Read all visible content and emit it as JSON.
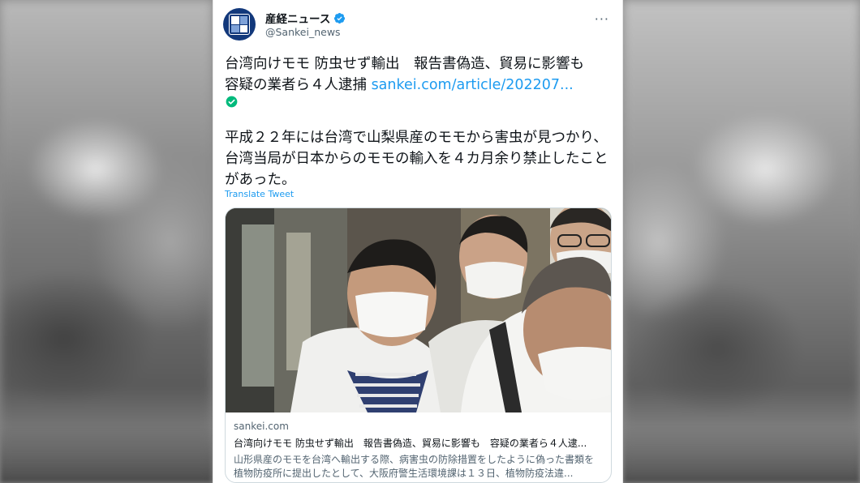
{
  "account": {
    "name": "産経ニュース",
    "handle": "@Sankei_news",
    "avatar_icon": "sankei-logo-icon",
    "verified_icon": "verified-badge-icon",
    "more_icon": "more-options-icon",
    "more_label": "···"
  },
  "tweet": {
    "line1_text": "台湾向けモモ 防虫せず輸出　報告書偽造、貿易に影響も　容疑の業者ら４人逮捕 ",
    "link_text": "sankei.com/article/202207...",
    "status_icon": "green-check-icon",
    "body_text": "平成２２年には台湾で山梨県産のモモから害虫が見つかり、台湾当局が日本からのモモの輸入を４カ月余り禁止したことがあった。",
    "translate_label": "Translate Tweet"
  },
  "card": {
    "domain": "sankei.com",
    "title": "台湾向けモモ 防虫せず輸出　報告書偽造、貿易に影響も　容疑の業者ら４人逮...",
    "description": "山形県産のモモを台湾へ輸出する際、病害虫の防除措置をしたように偽った書類を植物防疫所に提出したとして、大阪府警生活環境課は１３日、植物防疫法違..."
  },
  "colors": {
    "link": "#1d9bf0",
    "text": "#0f1419",
    "secondary": "#536471",
    "brand": "#12387b",
    "check_green": "#00ba7c"
  }
}
